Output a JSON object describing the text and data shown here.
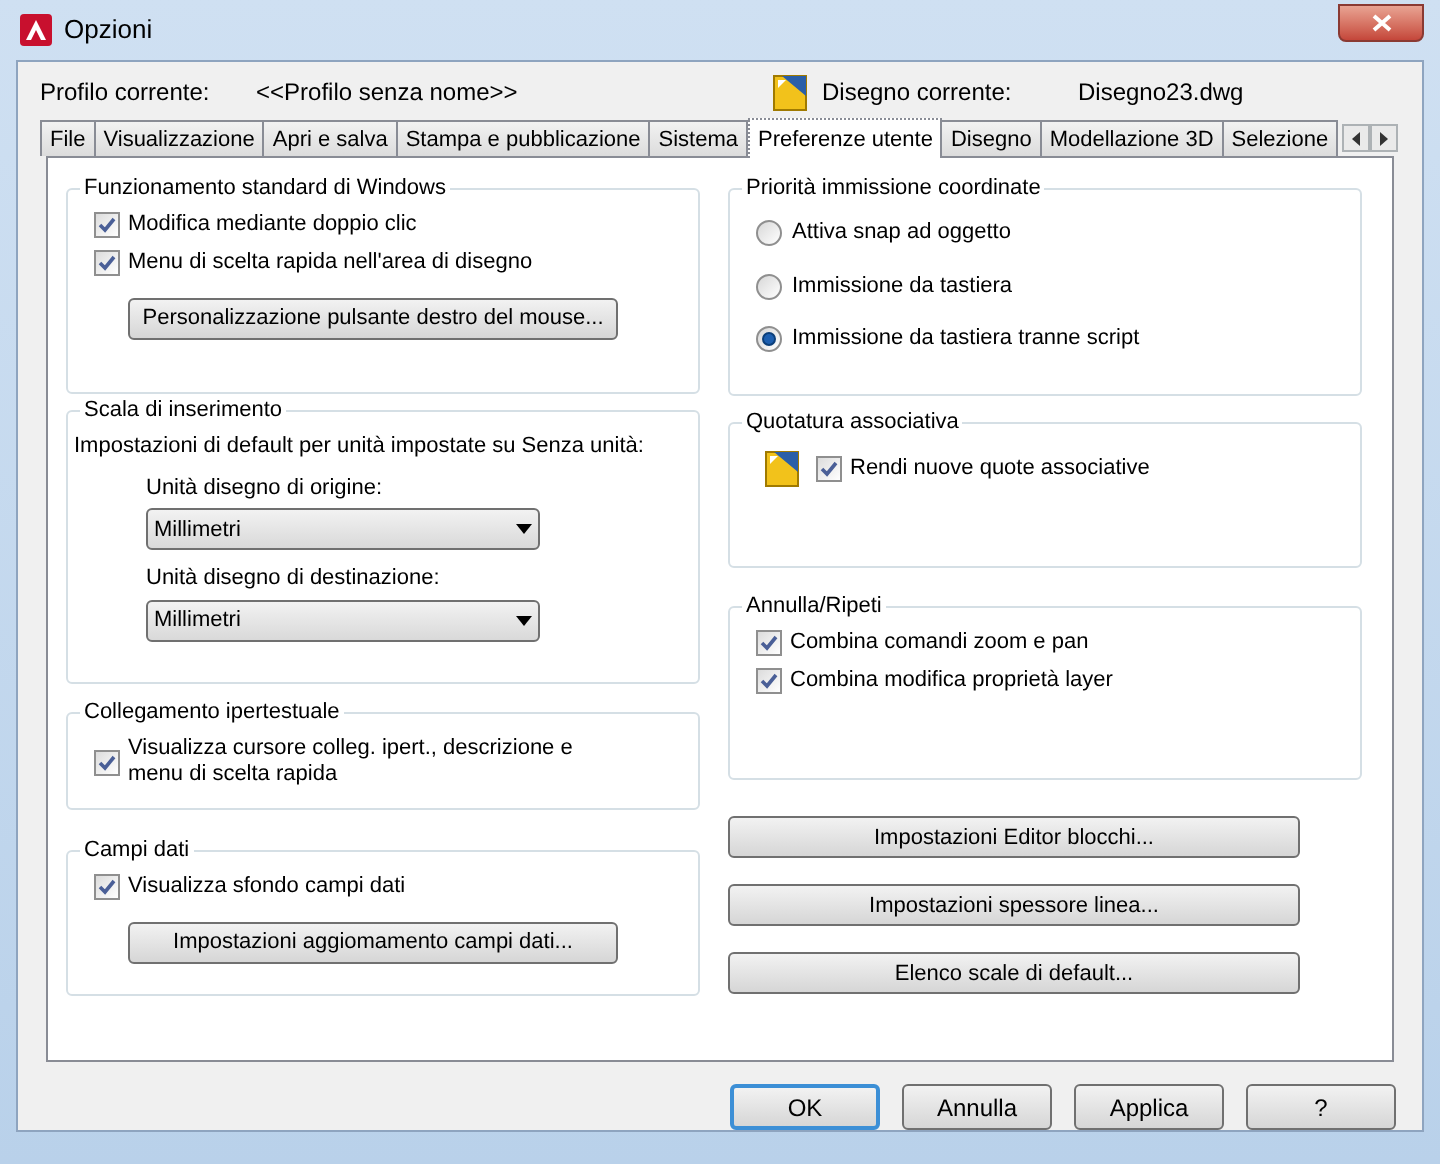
{
  "window": {
    "title": "Opzioni"
  },
  "profile": {
    "label": "Profilo corrente:",
    "value": "<<Profilo senza nome>>"
  },
  "drawing": {
    "label": "Disegno corrente:",
    "value": "Disegno23.dwg"
  },
  "tabs": [
    {
      "label": "File",
      "selected": false
    },
    {
      "label": "Visualizzazione",
      "selected": false
    },
    {
      "label": "Apri e salva",
      "selected": false
    },
    {
      "label": "Stampa e pubblicazione",
      "selected": false
    },
    {
      "label": "Sistema",
      "selected": false
    },
    {
      "label": "Preferenze utente",
      "selected": true
    },
    {
      "label": "Disegno",
      "selected": false
    },
    {
      "label": "Modellazione 3D",
      "selected": false
    },
    {
      "label": "Selezione",
      "selected": false
    }
  ],
  "left_groups": [
    {
      "title": "Funzionamento standard di Windows",
      "items": [
        {
          "kind": "checkbox",
          "label": "Modifica mediante doppio clic",
          "checked": true
        },
        {
          "kind": "checkbox",
          "label": "Menu di scelta rapida nell'area di disegno",
          "checked": true
        },
        {
          "kind": "button",
          "label": "Personalizzazione pulsante destro del mouse..."
        }
      ]
    },
    {
      "title": "Scala di inserimento",
      "items": [
        {
          "kind": "note",
          "label": "Impostazioni di default per unità impostate su Senza unità:"
        },
        {
          "kind": "select",
          "label": "Unità disegno di origine:",
          "value": "Millimetri"
        },
        {
          "kind": "select",
          "label": "Unità disegno di destinazione:",
          "value": "Millimetri"
        }
      ]
    },
    {
      "title": "Collegamento ipertestuale",
      "items": [
        {
          "kind": "checkbox",
          "label": "Visualizza cursore colleg. ipert., descrizione e menu di scelta rapida",
          "checked": true
        }
      ]
    },
    {
      "title": "Campi dati",
      "items": [
        {
          "kind": "checkbox",
          "label": "Visualizza sfondo campi dati",
          "checked": true
        },
        {
          "kind": "button",
          "label": "Impostazioni aggiomamento campi dati..."
        }
      ]
    }
  ],
  "right_groups": [
    {
      "title": "Priorità immissione coordinate",
      "items": [
        {
          "kind": "radio",
          "label": "Attiva snap ad oggetto",
          "selected": false
        },
        {
          "kind": "radio",
          "label": "Immissione da tastiera",
          "selected": false
        },
        {
          "kind": "radio",
          "label": "Immissione da tastiera tranne script",
          "selected": true
        }
      ]
    },
    {
      "title": "Quotatura associativa",
      "items": [
        {
          "kind": "icon_checkbox",
          "label": "Rendi nuove quote associative",
          "checked": true
        }
      ]
    },
    {
      "title": "Annulla/Ripeti",
      "items": [
        {
          "kind": "checkbox",
          "label": "Combina comandi zoom e pan",
          "checked": true
        },
        {
          "kind": "checkbox",
          "label": "Combina modifica proprietà layer",
          "checked": true
        }
      ]
    }
  ],
  "right_buttons": [
    "Impostazioni Editor blocchi...",
    "Impostazioni spessore linea...",
    "Elenco scale di default..."
  ],
  "footer_buttons": [
    {
      "label": "OK",
      "default": true
    },
    {
      "label": "Annulla",
      "default": false
    },
    {
      "label": "Applica",
      "default": false
    },
    {
      "label": "?",
      "default": false
    }
  ]
}
